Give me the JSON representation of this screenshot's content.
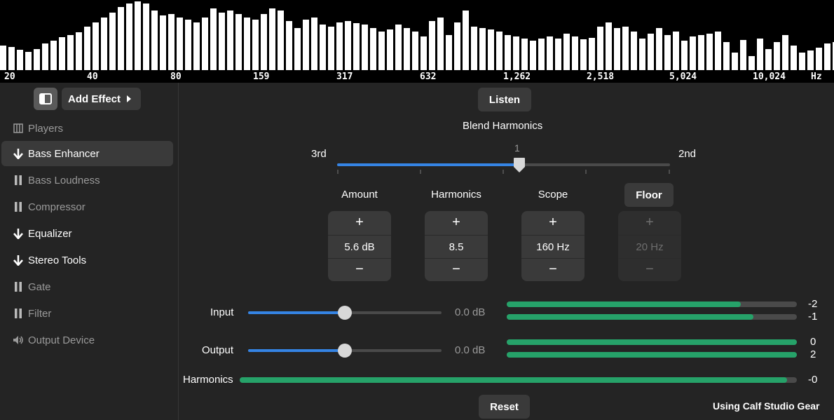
{
  "spectrum": {
    "bars": [
      0.35,
      0.33,
      0.29,
      0.26,
      0.3,
      0.38,
      0.42,
      0.47,
      0.5,
      0.54,
      0.62,
      0.68,
      0.75,
      0.82,
      0.9,
      0.95,
      0.98,
      0.95,
      0.85,
      0.78,
      0.8,
      0.75,
      0.72,
      0.68,
      0.75,
      0.88,
      0.82,
      0.85,
      0.8,
      0.75,
      0.72,
      0.8,
      0.88,
      0.85,
      0.7,
      0.6,
      0.72,
      0.75,
      0.65,
      0.62,
      0.68,
      0.7,
      0.67,
      0.65,
      0.6,
      0.55,
      0.58,
      0.65,
      0.6,
      0.55,
      0.48,
      0.7,
      0.75,
      0.5,
      0.68,
      0.85,
      0.62,
      0.6,
      0.58,
      0.55,
      0.5,
      0.48,
      0.45,
      0.42,
      0.45,
      0.48,
      0.45,
      0.52,
      0.48,
      0.44,
      0.46,
      0.62,
      0.68,
      0.6,
      0.62,
      0.55,
      0.45,
      0.52,
      0.6,
      0.5,
      0.55,
      0.42,
      0.48,
      0.5,
      0.52,
      0.55,
      0.4,
      0.25,
      0.43,
      0.2,
      0.45,
      0.3,
      0.4,
      0.5,
      0.35,
      0.25,
      0.28,
      0.32,
      0.38,
      0.4,
      0.45,
      0.3,
      0.25,
      0.22,
      0.3,
      0.2,
      0.28,
      0.35,
      0.3,
      0.32,
      0.28
    ],
    "freq_labels": [
      "20",
      "40",
      "80",
      "159",
      "317",
      "632",
      "1,262",
      "2,518",
      "5,024",
      "10,024"
    ],
    "unit": "Hz"
  },
  "sidebar": {
    "add_effect_label": "Add Effect",
    "items": [
      {
        "label": "Players",
        "icon": "players-icon",
        "state": "dim"
      },
      {
        "label": "Bass Enhancer",
        "icon": "arrow-down-icon",
        "state": "selected"
      },
      {
        "label": "Bass Loudness",
        "icon": "pause-icon",
        "state": "dim"
      },
      {
        "label": "Compressor",
        "icon": "pause-icon",
        "state": "dim"
      },
      {
        "label": "Equalizer",
        "icon": "arrow-down-icon",
        "state": "active"
      },
      {
        "label": "Stereo Tools",
        "icon": "arrow-down-icon",
        "state": "active"
      },
      {
        "label": "Gate",
        "icon": "pause-icon",
        "state": "dim"
      },
      {
        "label": "Filter",
        "icon": "pause-icon",
        "state": "dim"
      },
      {
        "label": "Output Device",
        "icon": "speaker-icon",
        "state": "dim"
      }
    ]
  },
  "main": {
    "listen_label": "Listen",
    "blend": {
      "title": "Blend Harmonics",
      "left_label": "3rd",
      "right_label": "2nd",
      "value": "1",
      "position_fraction": 0.55
    },
    "controls": [
      {
        "label": "Amount",
        "value": "5.6 dB",
        "plus": "+",
        "minus": "−"
      },
      {
        "label": "Harmonics",
        "value": "8.5",
        "plus": "+",
        "minus": "−"
      },
      {
        "label": "Scope",
        "value": "160 Hz",
        "plus": "+",
        "minus": "−"
      },
      {
        "label": "Floor",
        "value": "20 Hz",
        "plus": "+",
        "minus": "−"
      }
    ],
    "input": {
      "label": "Input",
      "value": "0.0 dB",
      "slider_fraction": 0.5
    },
    "output": {
      "label": "Output",
      "value": "0.0 dB",
      "slider_fraction": 0.5
    },
    "levels": {
      "input": [
        {
          "value": "-2",
          "fill": 0.82
        },
        {
          "value": "-1",
          "fill": 0.86
        }
      ],
      "output": [
        {
          "value": "0",
          "fill": 1.0
        },
        {
          "value": "2",
          "fill": 1.0
        }
      ],
      "harmonics": {
        "label": "Harmonics",
        "value": "-0",
        "fill": 0.98
      }
    },
    "reset_label": "Reset",
    "footer": "Using Calf Studio Gear"
  },
  "colors": {
    "accent": "#3584e4",
    "meter": "#26a269",
    "background": "#242424",
    "panel": "#3a3a3a"
  }
}
